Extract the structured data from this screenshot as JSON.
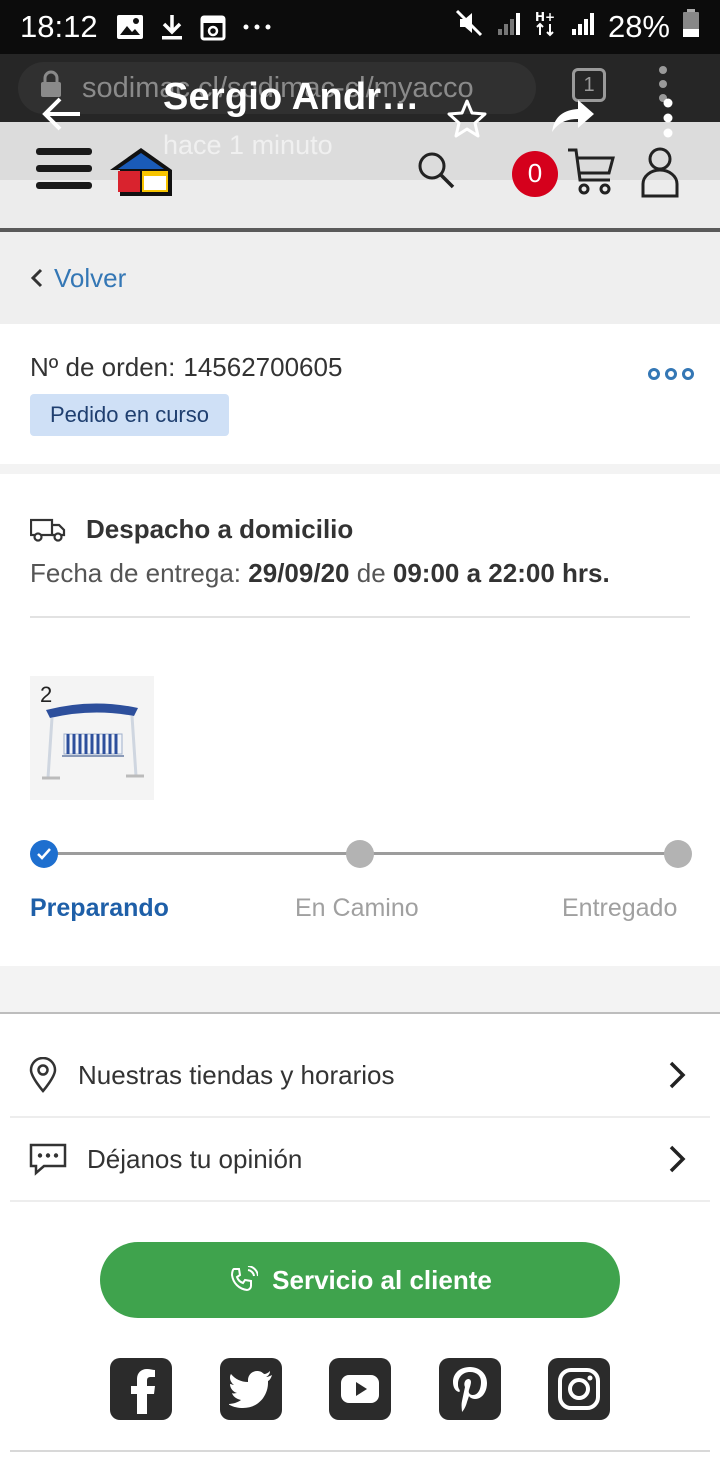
{
  "status_bar": {
    "time": "18:12",
    "battery": "28%"
  },
  "browser": {
    "url": "sodimac.cl/sodimac-cl/myacco",
    "tab_count": "1"
  },
  "notification": {
    "title": "Sergio Andr…",
    "subtitle": "hace 1 minuto"
  },
  "header": {
    "cart_count": "0"
  },
  "back": {
    "label": "Volver"
  },
  "order": {
    "label": "Nº de orden:",
    "number": "14562700605",
    "status": "Pedido en curso"
  },
  "delivery": {
    "type": "Despacho a domicilio",
    "date_label": "Fecha de entrega:",
    "date": "29/09/20",
    "connector": "de",
    "time_range": "09:00 a 22:00 hrs.",
    "quantity": "2"
  },
  "progress": {
    "current_step": 0,
    "steps": [
      "Preparando",
      "En Camino",
      "Entregado"
    ]
  },
  "footer": {
    "items": [
      "Nuestras tiendas y horarios",
      "Déjanos tu opinión"
    ],
    "cta": "Servicio al cliente",
    "socials": [
      "facebook-icon",
      "twitter-icon",
      "youtube-icon",
      "pinterest-icon",
      "instagram-icon"
    ]
  },
  "colors": {
    "accent_blue": "#3477b5",
    "cta_green": "#3fa34d",
    "badge_red": "#d5001c",
    "chip_bg": "#cfe0f6"
  }
}
